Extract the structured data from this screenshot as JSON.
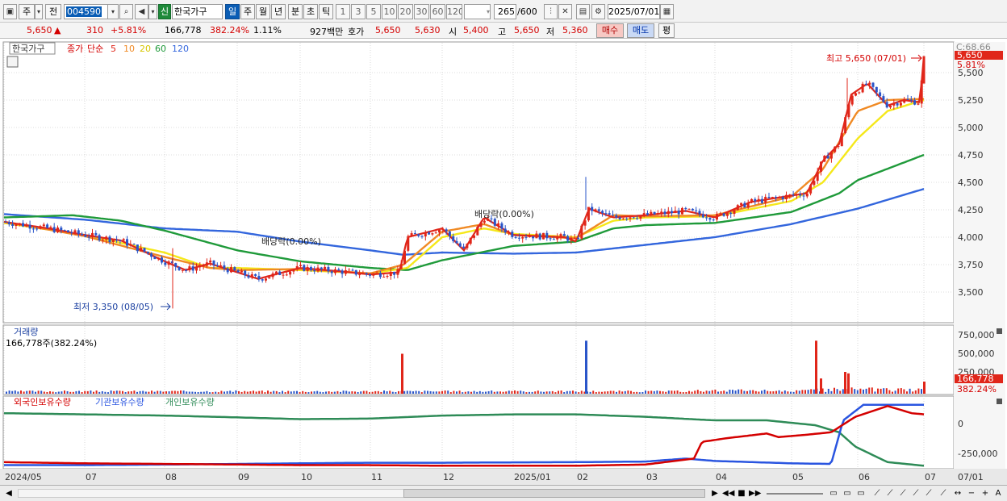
{
  "toolbar": {
    "mode_stock": "주",
    "mode_prev": "전",
    "code": "004590",
    "sin_label": "신",
    "name": "한국가구",
    "periods": [
      "일",
      "주",
      "월",
      "년",
      "분",
      "초",
      "틱"
    ],
    "active_period": "일",
    "nums": [
      "1",
      "3",
      "5",
      "10",
      "20",
      "30",
      "60",
      "120"
    ],
    "count": "265",
    "count_total": "/600",
    "date": "2025/07/01"
  },
  "quote": {
    "price": "5,650",
    "arrow": "▲",
    "change": "310",
    "change_pct": "+5.81%",
    "volume": "166,778",
    "vol_ratio": "382.24%",
    "turnover": "1.11%",
    "amount": "927백만",
    "hoga_label": "호가",
    "hoga_ask": "5,650",
    "hoga_bid": "5,630",
    "open_label": "시",
    "open": "5,400",
    "high_label": "고",
    "high": "5,650",
    "low_label": "저",
    "low": "5,360",
    "buy": "매수",
    "sell": "매도",
    "avg": "평"
  },
  "legend": {
    "stock": "한국가구",
    "closing": "종가",
    "simple": "단순",
    "ma": [
      "5",
      "10",
      "20",
      "60",
      "120"
    ]
  },
  "price_axis": {
    "top": "C:68.66",
    "last": "5,650",
    "last_pct": "5.81%",
    "ticks": [
      "5,500",
      "5,250",
      "5,000",
      "4,750",
      "4,500",
      "4,250",
      "4,000",
      "3,750",
      "3,500"
    ]
  },
  "annotations": {
    "high": "최고 5,650 (07/01)",
    "low": "최저 3,350 (08/05)",
    "div1": "배당락(0.00%)",
    "div2": "배당락(0.00%)"
  },
  "volume": {
    "title": "거래량",
    "value": "166,778주(382.24%)",
    "ticks": [
      "750,000",
      "500,000",
      "250,000"
    ],
    "last": "166,778",
    "last_pct": "382.24%"
  },
  "holdings": {
    "foreign": "외국인보유수량",
    "inst": "기관보유수량",
    "indiv": "개인보유수량",
    "ticks": [
      "0",
      "-250,000"
    ]
  },
  "xaxis": [
    "2024/05",
    "07",
    "08",
    "09",
    "10",
    "11",
    "12",
    "2025/01",
    "02",
    "03",
    "04",
    "05",
    "06",
    "07"
  ],
  "xaxis_right": "07/01",
  "colors": {
    "up": "#e0261a",
    "down": "#2a55c9",
    "ma5": "#e0261a",
    "ma10": "#f08a24",
    "ma20": "#f5e81a",
    "ma60": "#1f9a3a",
    "ma120": "#3366dd",
    "foreign": "#d40000",
    "inst": "#2a55e0",
    "indiv": "#2e8b57"
  },
  "chart_data": [
    {
      "type": "line",
      "title": "",
      "ylim": [
        3350,
        5700
      ],
      "series": [
        {
          "name": "종가",
          "x": [
            "2024/05",
            "2024/07",
            "2024/08",
            "2024/09",
            "2024/10",
            "2024/11",
            "2024/12",
            "2025/01",
            "2025/02",
            "2025/03",
            "2025/04",
            "2025/05",
            "2025/06",
            "2025/07"
          ],
          "values": [
            4150,
            4000,
            3700,
            3650,
            3700,
            3700,
            4050,
            4000,
            4250,
            4200,
            4200,
            4350,
            5250,
            5650
          ]
        },
        {
          "name": "60",
          "x": [
            "2024/05",
            "2024/07",
            "2024/08",
            "2024/09",
            "2024/10",
            "2024/11",
            "2024/12",
            "2025/01",
            "2025/02",
            "2025/03",
            "2025/04",
            "2025/05",
            "2025/06",
            "2025/07"
          ],
          "values": [
            4180,
            4120,
            3950,
            3800,
            3750,
            3700,
            3850,
            3950,
            4050,
            4120,
            4150,
            4250,
            4500,
            4750
          ]
        },
        {
          "name": "120",
          "x": [
            "2024/05",
            "2024/07",
            "2024/08",
            "2024/09",
            "2024/10",
            "2024/11",
            "2024/12",
            "2025/01",
            "2025/02",
            "2025/03",
            "2025/04",
            "2025/05",
            "2025/06",
            "2025/07"
          ],
          "values": [
            4120,
            4100,
            4080,
            4050,
            3950,
            3880,
            3860,
            3860,
            3870,
            3940,
            4000,
            4120,
            4270,
            4430
          ]
        }
      ]
    },
    {
      "type": "bar",
      "title": "거래량",
      "ylim": [
        0,
        800000
      ],
      "series": [
        {
          "name": "거래량",
          "x": [
            "2024/11",
            "2025/02",
            "2025/05",
            "2025/07"
          ],
          "values": [
            550000,
            730000,
            730000,
            166778
          ]
        }
      ]
    },
    {
      "type": "line",
      "title": "",
      "ylim": [
        -350000,
        100000
      ],
      "series": [
        {
          "name": "외국인보유수량",
          "values": [
            -330000,
            -340000,
            -340000,
            -345000,
            -345000,
            -340000,
            -345000,
            -345000,
            -345000,
            -330000,
            -120000,
            -60000,
            40000,
            60000
          ]
        },
        {
          "name": "기관보유수량",
          "values": [
            -345000,
            -345000,
            -340000,
            -330000,
            -325000,
            -320000,
            -320000,
            -315000,
            -315000,
            -300000,
            -320000,
            -330000,
            100000,
            100000
          ]
        },
        {
          "name": "개인보유수량",
          "values": [
            100000,
            90000,
            85000,
            75000,
            70000,
            70000,
            85000,
            100000,
            100000,
            80000,
            50000,
            20000,
            -240000,
            -330000
          ]
        }
      ]
    }
  ]
}
